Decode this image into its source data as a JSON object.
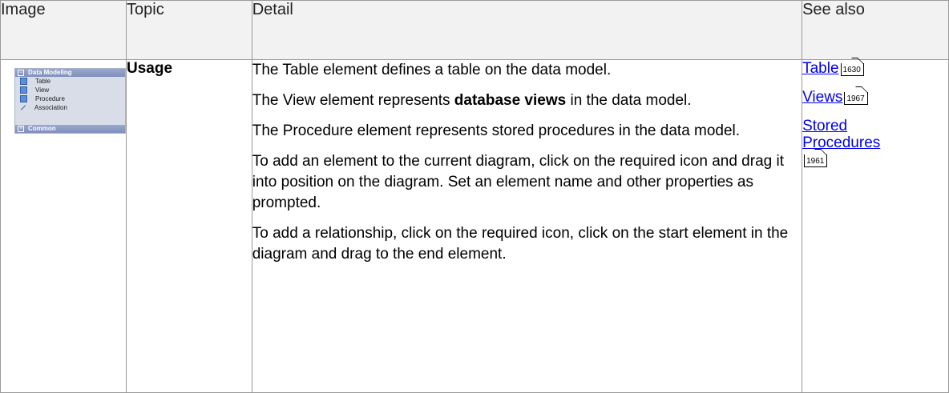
{
  "headers": {
    "image": "Image",
    "topic": "Topic",
    "detail": "Detail",
    "see_also": "See also"
  },
  "toolbox": {
    "title": "Data Modeling",
    "items": [
      "Table",
      "View",
      "Procedure",
      "Association"
    ],
    "footer": "Common"
  },
  "row": {
    "topic": "Usage",
    "detail": {
      "p1": "The Table element defines a table on the data model.",
      "p2_before": "The View element represents ",
      "p2_bold": "database views",
      "p2_after": " in the data model.",
      "p3": "The Procedure element represents stored procedures in the data model.",
      "p4": "To add an element to the current diagram, click on the required icon and drag it into position on the diagram. Set an element name and other properties as prompted.",
      "p5": "To add a relationship, click on the required icon, click on the start element in the diagram and drag to the end element."
    },
    "see_also": [
      {
        "label": "Table",
        "page": "1630"
      },
      {
        "label": "Views",
        "page": "1967"
      },
      {
        "label": "Stored Procedures",
        "page": "1961"
      }
    ]
  }
}
